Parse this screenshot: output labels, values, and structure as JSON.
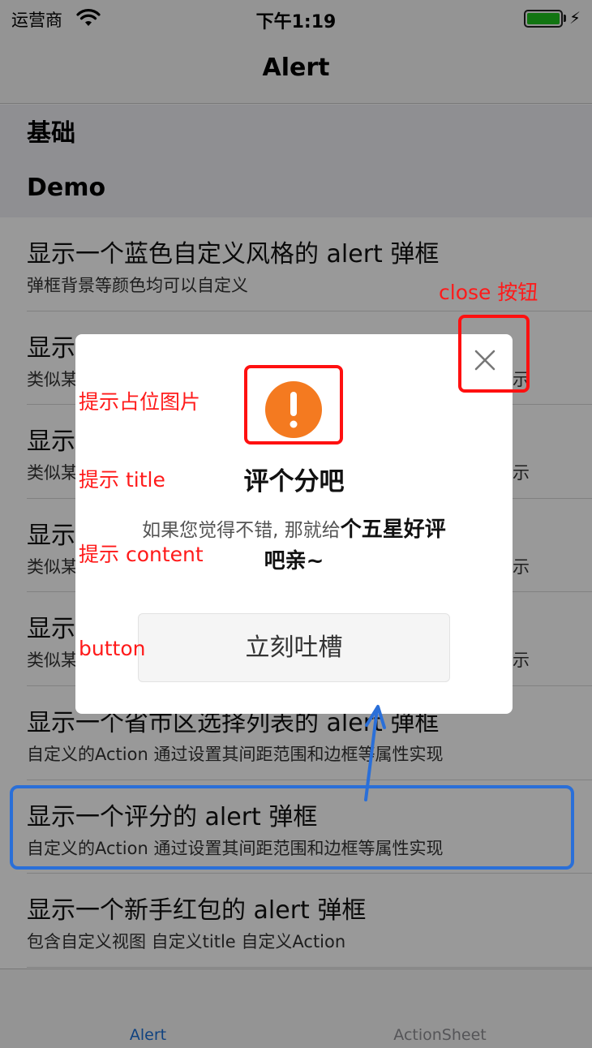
{
  "status_bar": {
    "carrier": "运营商",
    "time": "下午1:19",
    "charging_glyph": "⚡"
  },
  "nav_bar": {
    "title": "Alert"
  },
  "sections": [
    {
      "title": "基础"
    },
    {
      "title": "Demo"
    }
  ],
  "list": [
    {
      "title": "显示一个蓝色自定义风格的 alert 弹框",
      "subtitle": "弹框背景等颜色均可以自定义"
    },
    {
      "title": "显示一个仿字联号的 alert 弹框",
      "subtitle": "类似某"
    },
    {
      "title": "显示",
      "subtitle": "类似某"
    },
    {
      "title": "显示",
      "subtitle": "类似某"
    },
    {
      "title": "显示",
      "subtitle": "类似某"
    },
    {
      "title": "显示一个省市区选择列表的 alert 弹框",
      "subtitle": "自定义的Action 通过设置其间距范围和边框等属性实现"
    },
    {
      "title": "显示一个评分的 alert 弹框",
      "subtitle": "自定义的Action 通过设置其间距范围和边框等属性实现"
    },
    {
      "title": "显示一个新手红包的 alert 弹框",
      "subtitle": "包含自定义视图 自定义title 自定义Action"
    }
  ],
  "hidden_tail": "示",
  "tab_bar": {
    "tabs": [
      {
        "label": "Alert",
        "selected": true
      },
      {
        "label": "ActionSheet",
        "selected": false
      }
    ]
  },
  "alert": {
    "icon": "exclamation-icon",
    "icon_color": "#f47a20",
    "title": "评个分吧",
    "content_plain": "如果您觉得不错, 那就给",
    "content_bold": "个五星好评",
    "content_bold_2": "吧亲~",
    "button_label": "立刻吐槽",
    "close_icon": "close-icon"
  },
  "annotations": {
    "close": "close 按钮",
    "image": "提示占位图片",
    "title": "提示 title",
    "content": "提示 content",
    "button": "button"
  },
  "colors": {
    "accent": "#1a6fd6",
    "annotation_red": "#ff1a1a",
    "annotation_blue": "#2a6fd8",
    "battery_green": "#1fc31f"
  }
}
